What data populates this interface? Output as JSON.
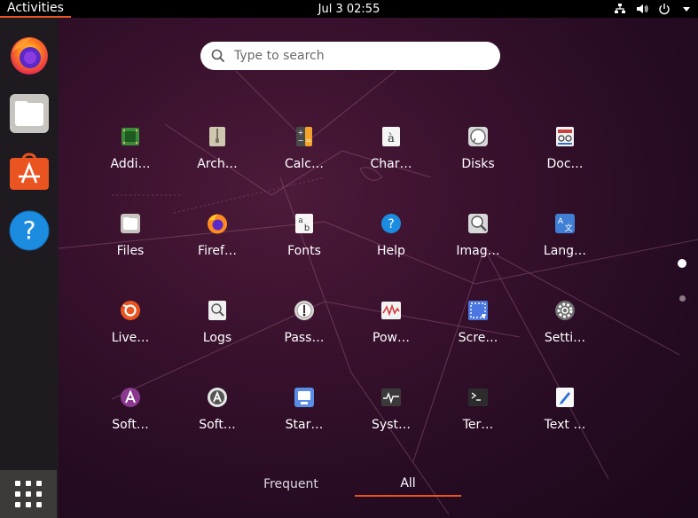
{
  "topbar": {
    "activities_label": "Activities",
    "clock": "Jul 3  02:55",
    "tray_icons": [
      "network-icon",
      "volume-icon",
      "power-icon",
      "menu-arrow-icon"
    ]
  },
  "dock": {
    "items": [
      {
        "name": "firefox",
        "icon": "firefox-icon"
      },
      {
        "name": "files",
        "icon": "files-icon"
      },
      {
        "name": "software",
        "icon": "software-store-icon"
      },
      {
        "name": "help",
        "icon": "help-icon"
      }
    ],
    "show_apps_icon": "app-grid-icon"
  },
  "search": {
    "placeholder": "Type to search"
  },
  "apps": [
    {
      "label": "Addi…",
      "icon": "chip-icon"
    },
    {
      "label": "Arch…",
      "icon": "archive-icon"
    },
    {
      "label": "Calc…",
      "icon": "calculator-icon"
    },
    {
      "label": "Char…",
      "icon": "character-map-icon"
    },
    {
      "label": "Disks",
      "icon": "disks-icon"
    },
    {
      "label": "Doc…",
      "icon": "document-viewer-icon"
    },
    {
      "label": "Files",
      "icon": "files-icon"
    },
    {
      "label": "Firef…",
      "icon": "firefox-icon"
    },
    {
      "label": "Fonts",
      "icon": "fonts-icon"
    },
    {
      "label": "Help",
      "icon": "help-icon"
    },
    {
      "label": "Imag…",
      "icon": "image-viewer-icon"
    },
    {
      "label": "Lang…",
      "icon": "language-icon"
    },
    {
      "label": "Live…",
      "icon": "livepatch-icon"
    },
    {
      "label": "Logs",
      "icon": "logs-icon"
    },
    {
      "label": "Pass…",
      "icon": "passwords-icon"
    },
    {
      "label": "Pow…",
      "icon": "power-statistics-icon"
    },
    {
      "label": "Scre…",
      "icon": "screenshot-icon"
    },
    {
      "label": "Setti…",
      "icon": "settings-gear-icon"
    },
    {
      "label": "Soft…",
      "icon": "software-updater-icon"
    },
    {
      "label": "Soft…",
      "icon": "software-properties-icon"
    },
    {
      "label": "Star…",
      "icon": "startup-disk-icon"
    },
    {
      "label": "Syst…",
      "icon": "system-monitor-icon"
    },
    {
      "label": "Ter…",
      "icon": "terminal-icon"
    },
    {
      "label": "Text …",
      "icon": "text-editor-icon"
    }
  ],
  "tabs": {
    "frequent": "Frequent",
    "all": "All",
    "active": "all"
  },
  "colors": {
    "accent": "#e95420",
    "topbar": "#000000",
    "dock": "#1e1a1f"
  }
}
